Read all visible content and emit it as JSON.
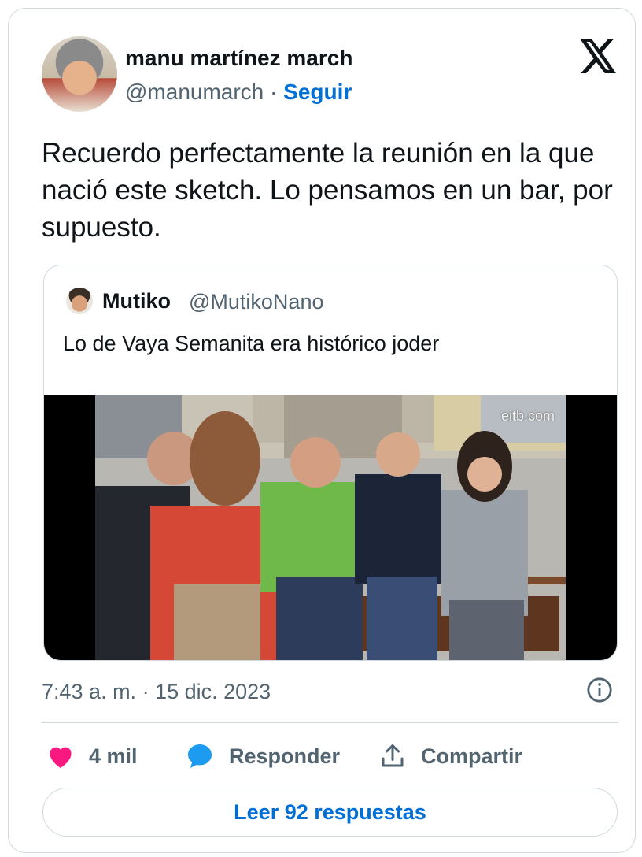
{
  "author": {
    "name": "manu martínez march",
    "handle": "@manumarch",
    "separator": "·",
    "follow_label": "Seguir"
  },
  "tweet": {
    "text": "Recuerdo perfectamente la reunión en la que nació este sketch. Lo pensamos en un bar, por supuesto."
  },
  "quoted_tweet": {
    "name": "Mutiko",
    "handle": "@MutikoNano",
    "text": "Lo de Vaya Semanita era histórico joder",
    "media_watermark": "eitb.com"
  },
  "meta": {
    "timestamp": "7:43 a. m. · 15 dic. 2023"
  },
  "actions": {
    "likes_count": "4 mil",
    "reply_label": "Responder",
    "share_label": "Compartir",
    "read_replies_label": "Leer 92 respuestas"
  },
  "icons": {
    "platform": "x-logo-icon",
    "like": "heart-icon",
    "reply": "speech-bubble-icon",
    "share": "share-upload-icon",
    "info": "info-icon"
  },
  "colors": {
    "link_blue": "#006fd6",
    "like_pink": "#f91880",
    "reply_blue": "#1d9bf0",
    "secondary_text": "#536471",
    "border": "#cfd9de"
  }
}
